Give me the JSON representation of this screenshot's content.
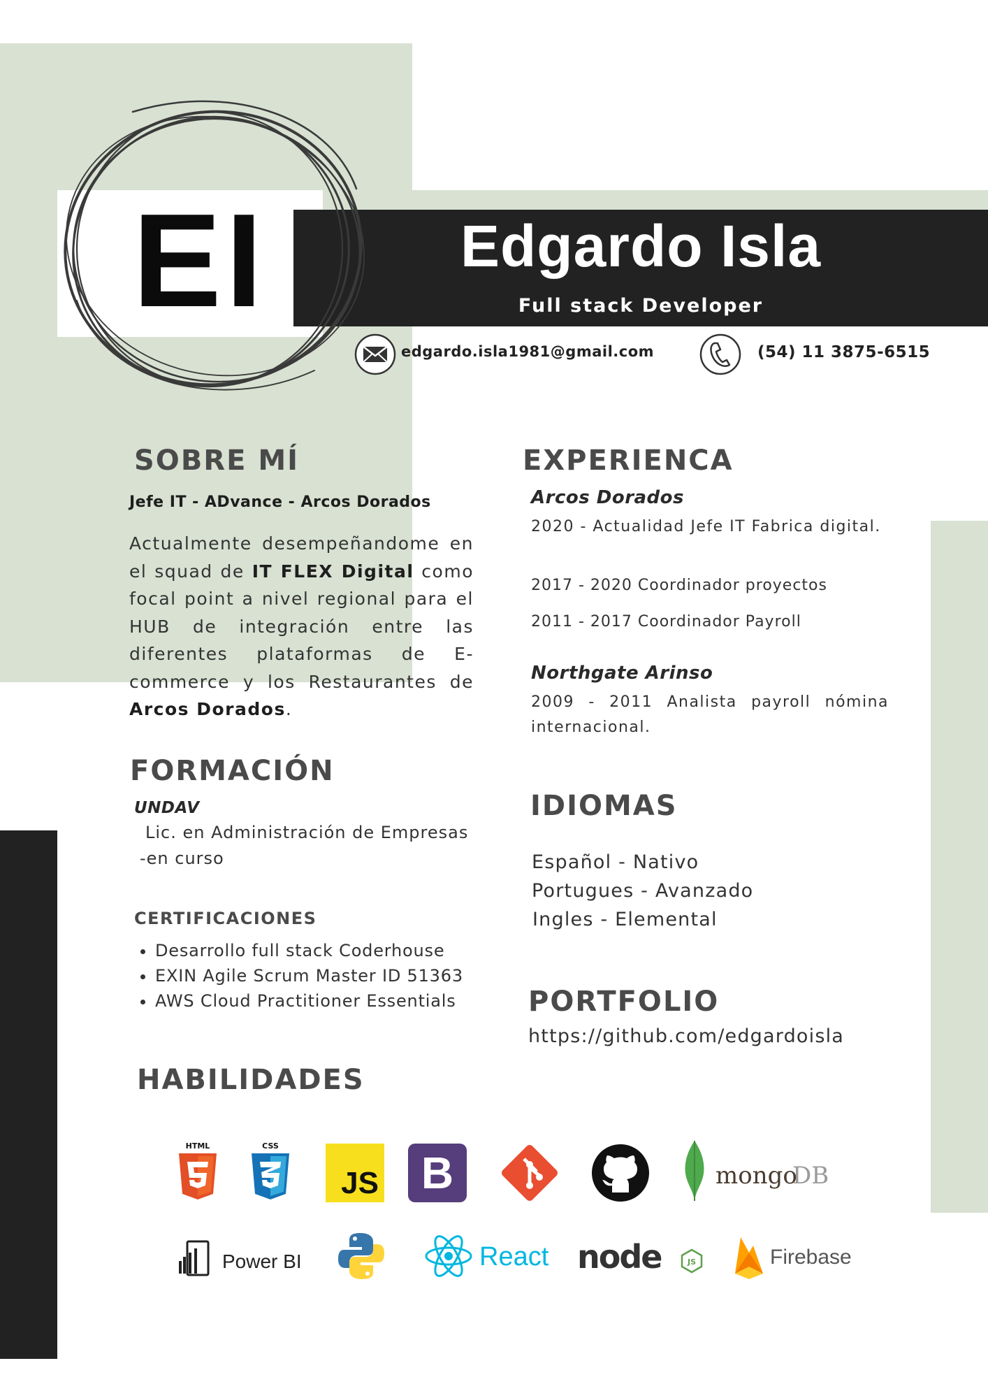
{
  "header": {
    "monogram": "EI",
    "name": "Edgardo Isla",
    "role": "Full stack Developer",
    "email": "edgardo.isla1981@gmail.com",
    "phone": "(54) 11 3875-6515"
  },
  "about": {
    "title": "SOBRE MÍ",
    "subtitle": "Jefe IT - ADvance - Arcos Dorados",
    "text_1": "Actualmente desempeñandome en el squad de ",
    "bold_1": "IT FLEX Digital",
    "text_2": " como focal point a nivel regional para el HUB de integración entre las diferentes plataformas de E-commerce y los Restaurantes de ",
    "bold_2": "Arcos Dorados",
    "text_3": "."
  },
  "experience": {
    "title": "EXPERIENCA",
    "companies": [
      {
        "name": "Arcos Dorados",
        "roles": [
          "2020 - Actualidad Jefe IT Fabrica digital.",
          "2017 - 2020 Coordinador proyectos",
          "2011 - 2017 Coordinador Payroll"
        ]
      },
      {
        "name": "Northgate Arinso",
        "roles": [
          "2009 - 2011 Analista payroll nómina internacional."
        ]
      }
    ]
  },
  "education": {
    "title": "FORMACIÓN",
    "institution": "UNDAV",
    "degree_line_1": "Lic. en Administración de Empresas",
    "degree_line_2": "-en curso"
  },
  "certifications": {
    "title": "CERTIFICACIONES",
    "items": [
      "Desarrollo full stack Coderhouse",
      "EXIN Agile Scrum Master ID 51363",
      "AWS Cloud Practitioner Essentials"
    ]
  },
  "languages": {
    "title": "IDIOMAS",
    "items": [
      "Español - Nativo",
      "Portugues - Avanzado",
      "Ingles - Elemental"
    ]
  },
  "portfolio": {
    "title": "PORTFOLIO",
    "url": "https://github.com/edgardoisla"
  },
  "skills": {
    "title": "HABILIDADES",
    "html_label": "HTML",
    "css_label": "CSS",
    "js_label": "JS",
    "bootstrap_label": "B",
    "mongo_label_a": "mongo",
    "mongo_label_b": "DB",
    "powerbi_label": "Power BI",
    "react_label": "React",
    "node_label": "node",
    "node_js_label": "JS",
    "firebase_label": "Firebase"
  },
  "colors": {
    "green_panel": "#d8e1d2",
    "dark_band": "#222222",
    "heading": "#4a4a4a"
  }
}
